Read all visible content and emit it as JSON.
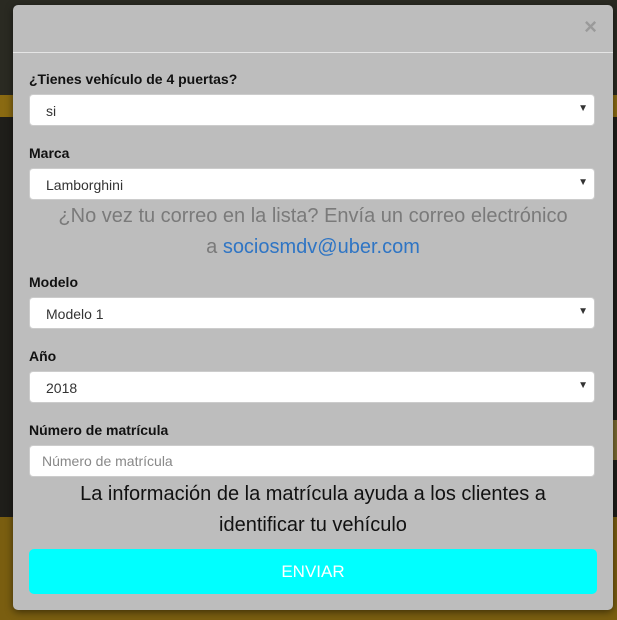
{
  "modal": {
    "close_symbol": "×"
  },
  "fields": {
    "doors": {
      "label": "¿Tienes vehículo de 4 puertas?",
      "value": "si"
    },
    "brand": {
      "label": "Marca",
      "value": "Lamborghini"
    },
    "model": {
      "label": "Modelo",
      "value": "Modelo 1"
    },
    "year": {
      "label": "Año",
      "value": "2018"
    },
    "plate": {
      "label": "Número de matrícula",
      "value": "",
      "placeholder": "Número de matrícula"
    }
  },
  "email_note": {
    "line1": "¿No vez tu correo en la lista? Envía un correo electrónico",
    "prefix": "a ",
    "email": "sociosmdv@uber.com"
  },
  "plate_note": {
    "line1": "La información de la matrícula ayuda a los clientes a",
    "line2": "identificar tu vehículo"
  },
  "submit_label": "ENVIAR",
  "icons": {
    "caret": "chevron-down-icon",
    "close": "close-icon"
  },
  "colors": {
    "modal_bg": "#bdbdbd",
    "submit_bg": "#00ffff",
    "link": "#2f75c4"
  }
}
